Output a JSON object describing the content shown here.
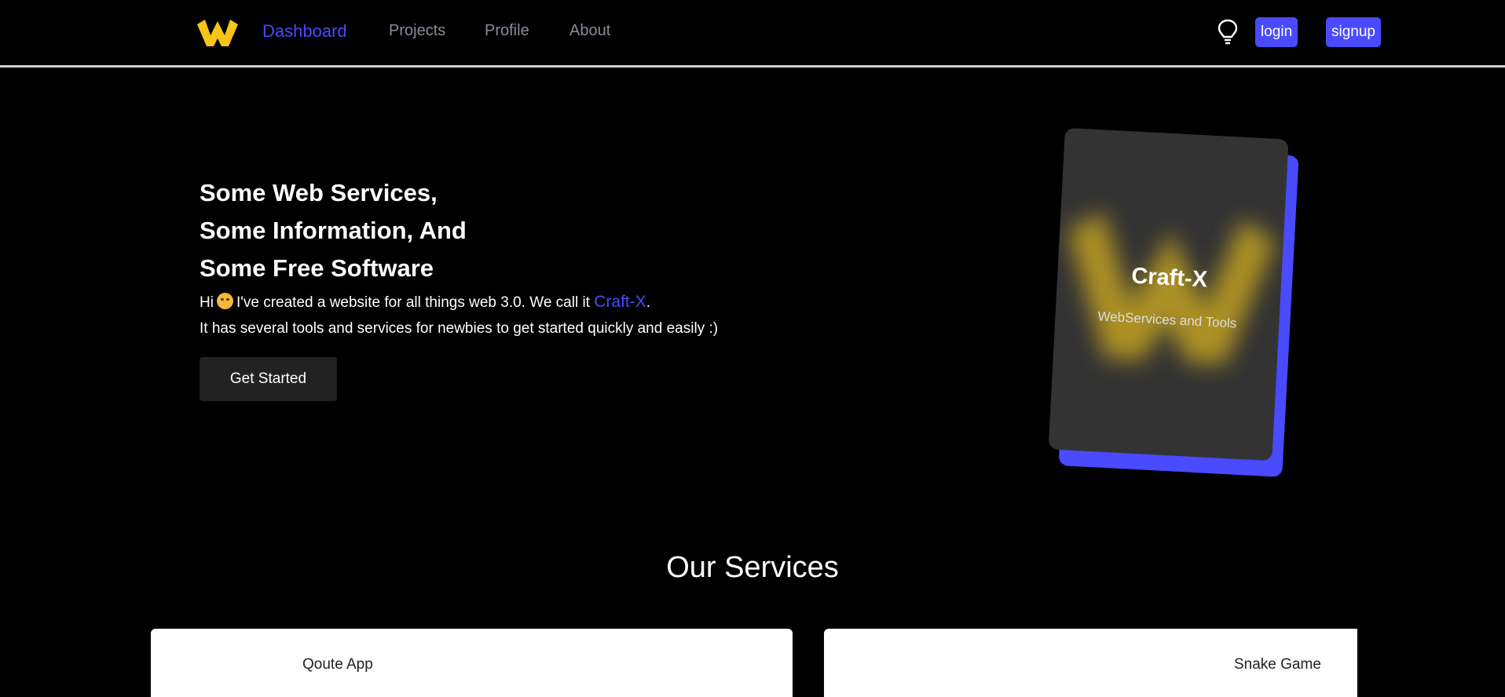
{
  "nav": {
    "links": [
      {
        "label": "Dashboard",
        "active": true
      },
      {
        "label": "Projects",
        "active": false
      },
      {
        "label": "Profile",
        "active": false
      },
      {
        "label": "About",
        "active": false
      }
    ],
    "login_label": "login",
    "signup_label": "signup",
    "logo_icon": "w-logo-icon",
    "theme_icon": "lightbulb-icon"
  },
  "hero": {
    "title_lines": [
      "Some Web Services,",
      "Some Information, And",
      "Some Free Software"
    ],
    "intro_prefix": "Hi",
    "intro_emoji": "smiling-face-emoji",
    "intro_middle": "I've created a website for all things web 3.0. We call it",
    "brand_name": "Craft-X",
    "intro_suffix": ".",
    "intro_line2": "It has several tools and services for newbies to get started quickly and easily :)",
    "cta_label": "Get Started"
  },
  "card": {
    "title": "Craft-X",
    "subtitle": "WebServices and Tools"
  },
  "services": {
    "heading": "Our Services",
    "items": [
      {
        "label": "Qoute App"
      },
      {
        "label": "Snake Game"
      }
    ]
  },
  "colors": {
    "accent": "#4a4aff",
    "logo": "#f5c518",
    "background": "#000000",
    "card": "#333333"
  }
}
